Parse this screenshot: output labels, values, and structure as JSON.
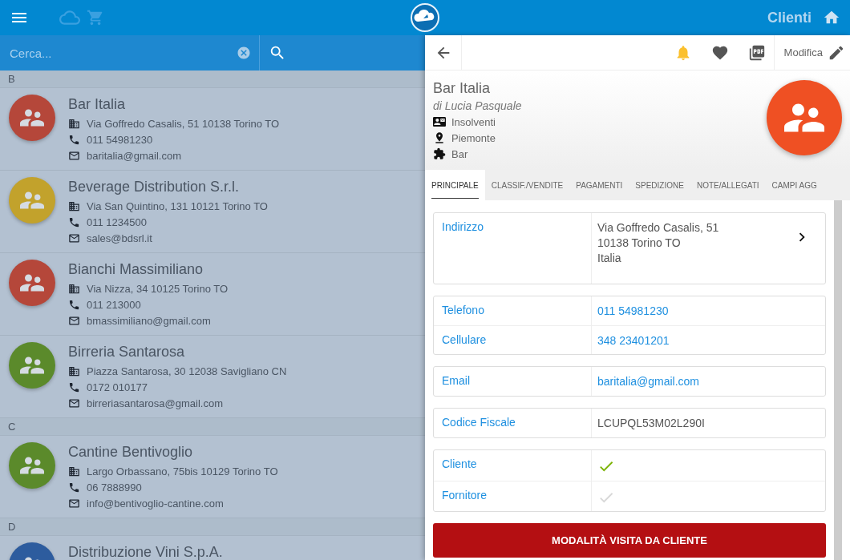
{
  "app_bar": {
    "title": "Clienti"
  },
  "search": {
    "placeholder": "Cerca..."
  },
  "customer_list": [
    {
      "letter": "B",
      "customers": [
        {
          "name": "Bar Italia",
          "address": "Via Goffredo Casalis, 51 10138 Torino TO",
          "phone": "011 54981230",
          "email": "baritalia@gmail.com",
          "color": "#b5473a"
        },
        {
          "name": "Beverage Distribution S.r.l.",
          "address": "Via San Quintino, 131 10121 Torino TO",
          "phone": "011 1234500",
          "email": "sales@bdsrl.it",
          "color": "#c2a22c"
        },
        {
          "name": "Bianchi Massimiliano",
          "address": "Via Nizza, 34 10125 Torino TO",
          "phone": "011 213000",
          "email": "bmassimiliano@gmail.com",
          "color": "#b5473a"
        },
        {
          "name": "Birreria Santarosa",
          "address": "Piazza Santarosa, 30 12038 Savigliano CN",
          "phone": "0172 010177",
          "email": "birreriasantarosa@gmail.com",
          "color": "#5b8a2b"
        }
      ]
    },
    {
      "letter": "C",
      "customers": [
        {
          "name": "Cantine Bentivoglio",
          "address": "Largo Orbassano, 75bis 10129 Torino TO",
          "phone": "06 7888990",
          "email": "info@bentivoglio-cantine.com",
          "color": "#5b8a2b"
        }
      ]
    },
    {
      "letter": "D",
      "customers": [
        {
          "name": "Distribuzione Vini S.p.A.",
          "color": "#2d5c9e"
        }
      ]
    }
  ],
  "detail": {
    "toolbar": {
      "edit_label": "Modifica"
    },
    "name": "Bar Italia",
    "subtitle": "di Lucia Pasquale",
    "meta": [
      {
        "kind": "category",
        "text": "Insolventi"
      },
      {
        "kind": "region",
        "text": "Piemonte"
      },
      {
        "kind": "type",
        "text": "Bar"
      }
    ],
    "tabs": [
      {
        "label": "PRINCIPALE",
        "selected": true
      },
      {
        "label": "CLASSIF./VENDITE",
        "selected": false
      },
      {
        "label": "PAGAMENTI",
        "selected": false
      },
      {
        "label": "SPEDIZIONE",
        "selected": false
      },
      {
        "label": "NOTE/ALLEGATI",
        "selected": false
      },
      {
        "label": "CAMPI AGG",
        "selected": false
      }
    ],
    "groups": [
      [
        {
          "kind": "address",
          "label": "Indirizzo",
          "lines": [
            "Via Goffredo Casalis, 51",
            "10138 Torino TO",
            "Italia"
          ]
        }
      ],
      [
        {
          "kind": "link",
          "label": "Telefono",
          "value": "011 54981230"
        },
        {
          "kind": "link",
          "label": "Cellulare",
          "value": "348 23401201"
        }
      ],
      [
        {
          "kind": "link",
          "label": "Email",
          "value": "baritalia@gmail.com"
        }
      ],
      [
        {
          "kind": "text",
          "label": "Codice Fiscale",
          "value": "LCUPQL53M02L290I"
        }
      ],
      [
        {
          "kind": "check",
          "label": "Cliente",
          "checked": true
        },
        {
          "kind": "check",
          "label": "Fornitore",
          "checked": false
        }
      ]
    ],
    "action_button": "MODALITÀ VISITA DA CLIENTE"
  }
}
